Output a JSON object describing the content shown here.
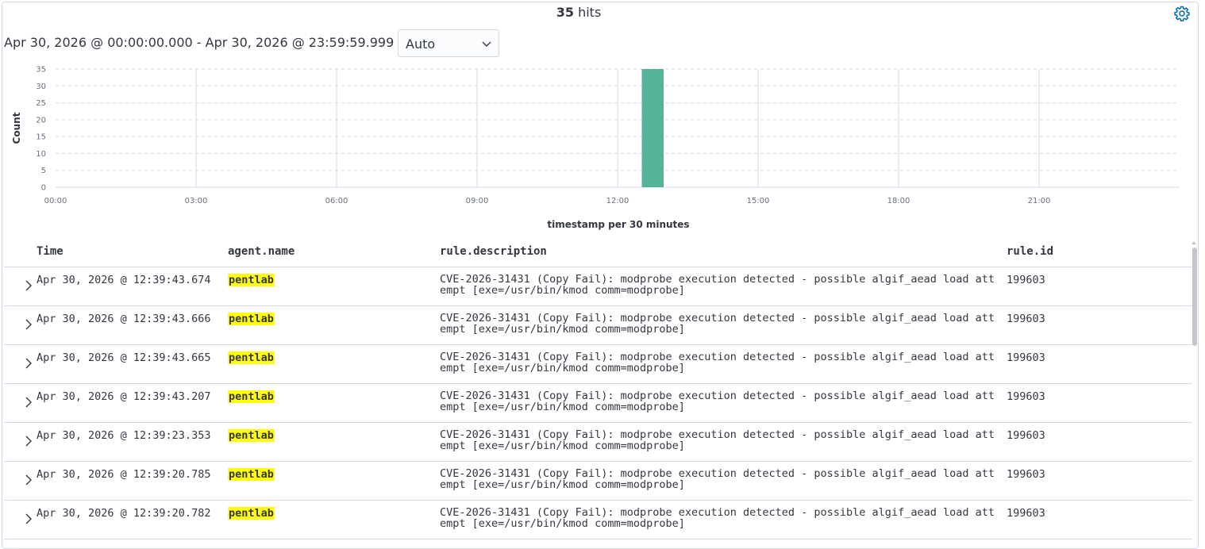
{
  "header": {
    "hits_count": "35",
    "hits_label": "hits"
  },
  "range": {
    "text": "Apr 30, 2026 @ 00:00:00.000 - Apr 30, 2026 @ 23:59:59.999 per",
    "interval_value": "Auto"
  },
  "icons": {
    "settings": "gear-icon",
    "interval": "chevron-down-icon",
    "expand": "chevron-right-icon",
    "scroll": "arrow-up-icon"
  },
  "colors": {
    "bar": "#54b399",
    "highlight": "#ffff00",
    "accent": "#006bb4"
  },
  "chart_data": {
    "type": "bar",
    "ylabel": "Count",
    "xlabel": "timestamp per 30 minutes",
    "ylim": [
      0,
      35
    ],
    "yticks": [
      "35",
      "30",
      "25",
      "20",
      "15",
      "10",
      "5",
      "0"
    ],
    "xticks": [
      "00:00",
      "03:00",
      "06:00",
      "09:00",
      "12:00",
      "15:00",
      "18:00",
      "21:00"
    ],
    "bucket_minutes": 30,
    "buckets": [
      {
        "start": "12:30",
        "value": 35
      }
    ],
    "grid": true
  },
  "table": {
    "columns": [
      "Time",
      "agent.name",
      "rule.description",
      "rule.id"
    ],
    "rows": [
      {
        "time": "Apr 30, 2026 @ 12:39:43.674",
        "agent": "pentlab",
        "description": "CVE-2026-31431 (Copy Fail): modprobe execution detected - possible algif_aead load attempt [exe=/usr/bin/kmod comm=modprobe]",
        "rule_id": "199603"
      },
      {
        "time": "Apr 30, 2026 @ 12:39:43.666",
        "agent": "pentlab",
        "description": "CVE-2026-31431 (Copy Fail): modprobe execution detected - possible algif_aead load attempt [exe=/usr/bin/kmod comm=modprobe]",
        "rule_id": "199603"
      },
      {
        "time": "Apr 30, 2026 @ 12:39:43.665",
        "agent": "pentlab",
        "description": "CVE-2026-31431 (Copy Fail): modprobe execution detected - possible algif_aead load attempt [exe=/usr/bin/kmod comm=modprobe]",
        "rule_id": "199603"
      },
      {
        "time": "Apr 30, 2026 @ 12:39:43.207",
        "agent": "pentlab",
        "description": "CVE-2026-31431 (Copy Fail): modprobe execution detected - possible algif_aead load attempt [exe=/usr/bin/kmod comm=modprobe]",
        "rule_id": "199603"
      },
      {
        "time": "Apr 30, 2026 @ 12:39:23.353",
        "agent": "pentlab",
        "description": "CVE-2026-31431 (Copy Fail): modprobe execution detected - possible algif_aead load attempt [exe=/usr/bin/kmod comm=modprobe]",
        "rule_id": "199603"
      },
      {
        "time": "Apr 30, 2026 @ 12:39:20.785",
        "agent": "pentlab",
        "description": "CVE-2026-31431 (Copy Fail): modprobe execution detected - possible algif_aead load attempt [exe=/usr/bin/kmod comm=modprobe]",
        "rule_id": "199603"
      },
      {
        "time": "Apr 30, 2026 @ 12:39:20.782",
        "agent": "pentlab",
        "description": "CVE-2026-31431 (Copy Fail): modprobe execution detected - possible algif_aead load attempt [exe=/usr/bin/kmod comm=modprobe]",
        "rule_id": "199603"
      }
    ]
  }
}
